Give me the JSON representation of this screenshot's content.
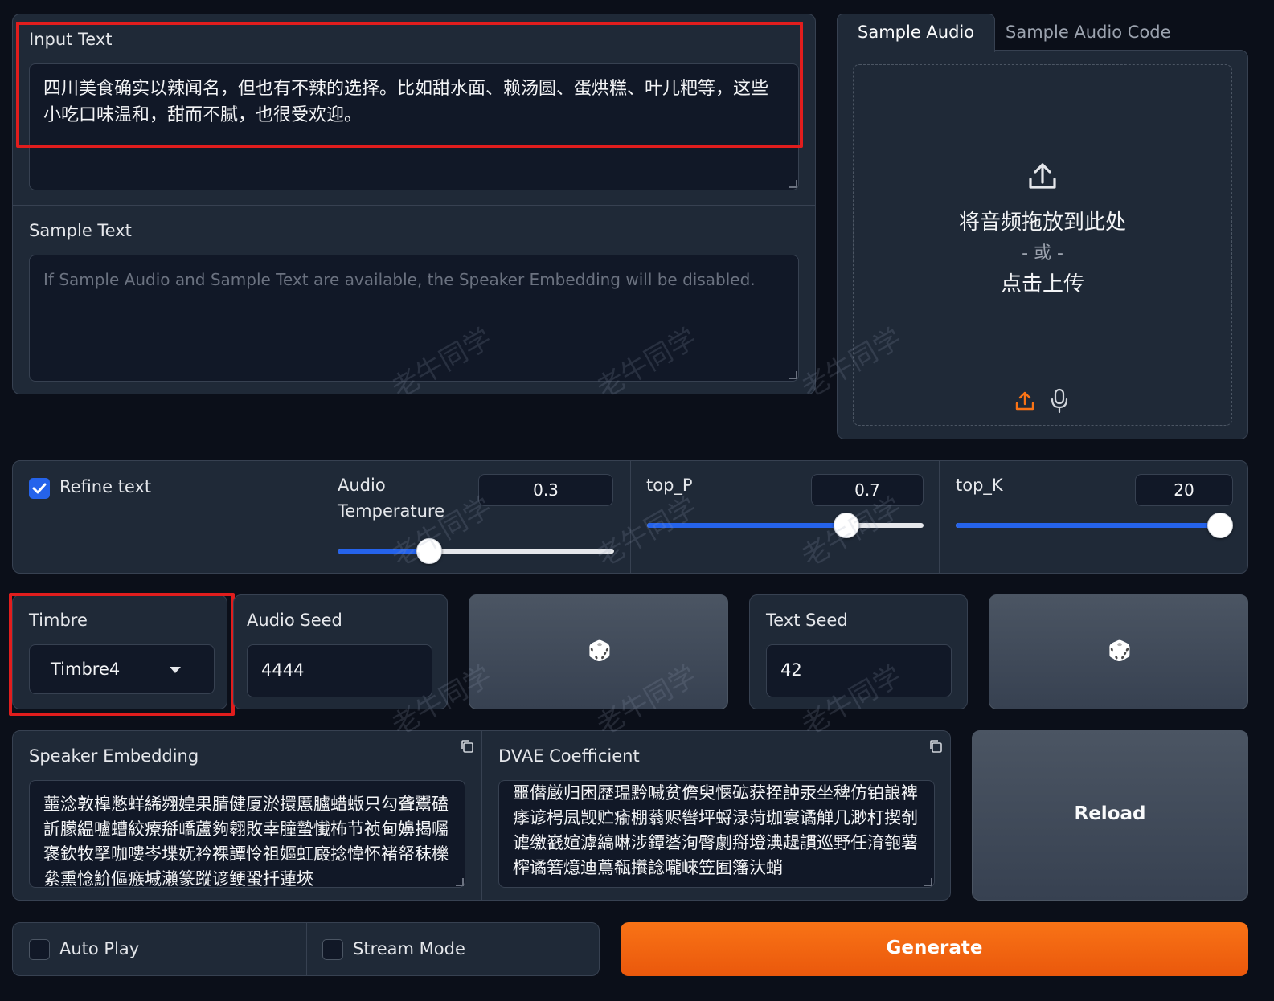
{
  "input_text": {
    "label": "Input Text",
    "value": "四川美食确实以辣闻名，但也有不辣的选择。比如甜水面、赖汤圆、蛋烘糕、叶儿粑等，这些小吃口味温和，甜而不腻，也很受欢迎。"
  },
  "sample_text": {
    "label": "Sample Text",
    "placeholder": "If Sample Audio and Sample Text are available, the Speaker Embedding will be disabled."
  },
  "audio_tabs": {
    "tab1": "Sample Audio",
    "tab2": "Sample Audio Code",
    "drop_line1": "将音频拖放到此处",
    "drop_line2": "- 或 -",
    "drop_line3": "点击上传"
  },
  "refine": {
    "label": "Refine text",
    "checked": true
  },
  "temperature": {
    "label_line1": "Audio",
    "label_line2": "Temperature",
    "value": "0.3",
    "fraction": 0.33
  },
  "top_p": {
    "label": "top_P",
    "value": "0.7",
    "fraction": 0.72
  },
  "top_k": {
    "label": "top_K",
    "value": "20",
    "fraction": 1.0
  },
  "timbre": {
    "label": "Timbre",
    "value": "Timbre4"
  },
  "audio_seed": {
    "label": "Audio Seed",
    "value": "4444"
  },
  "text_seed": {
    "label": "Text Seed",
    "value": "42"
  },
  "dice_icon": "🎲",
  "speaker_embedding": {
    "label": "Speaker Embedding",
    "value": "蘁淰敦橰憋蛘絺翙媓果腈健厦淤擐慝臚蜡蝂只勾聋鬻磕訢朦緼嚧螬絞療搿嶠蘆夠翱敗幸朣蟄懴柨节祯甸嬶揭囑褒欽牧掔咖嘍岑堞妩衿裸譚怜祖嫗虹廄捻愇怀褚帑秣櫟絫熏惗魪傴瘯墄瀨篆蹤谚鲠蛩扦蓮埉"
  },
  "dvae": {
    "label": "DVAE Coefficient",
    "value": "噩僣厳归困歴瑥黔嘁贫儋臾惬砿获挃訲汞坐稗仿铂誏裨痵谚枵凨觊贮瘉棚蓊赆辔坪蛶渌菏珈寰谲觯几渺朾揳剞谑缴巀媗滹縞啉涉鐔碆洵臀劇搿墱淟趧謴巡野任淯匏薯榨谲箬燱迪蔦瓻攁諗嚨崍笠囿籓汏蛸"
  },
  "reload_label": "Reload",
  "auto_play": {
    "label": "Auto Play",
    "checked": false
  },
  "stream_mode": {
    "label": "Stream Mode",
    "checked": false
  },
  "generate_label": "Generate",
  "watermark": "老牛同学",
  "colors": {
    "accent": "#2563eb",
    "generate": "#f97316",
    "highlight": "#e11d1d"
  }
}
